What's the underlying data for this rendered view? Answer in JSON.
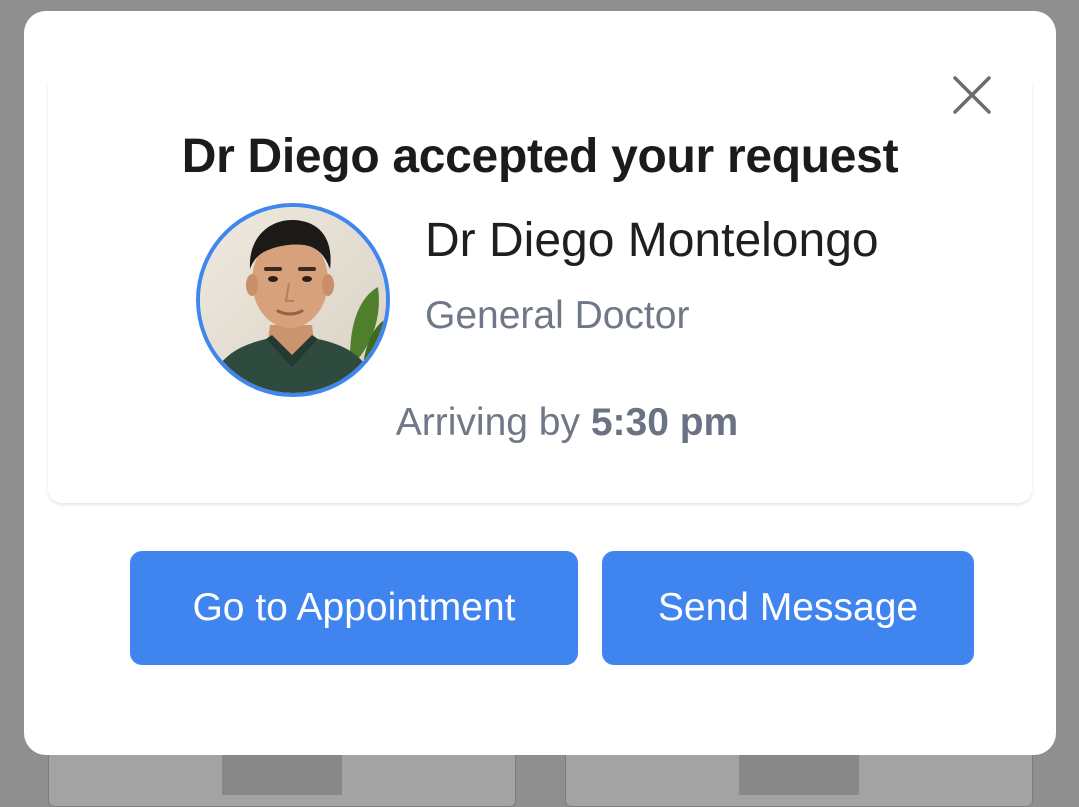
{
  "modal": {
    "title": "Dr Diego accepted your request",
    "doctor": {
      "name": "Dr Diego Montelongo",
      "role": "General Doctor"
    },
    "arrival_prefix": "Arriving by ",
    "arrival_time": "5:30 pm",
    "buttons": {
      "go_to_appointment": "Go to Appointment",
      "send_message": "Send Message"
    },
    "icons": {
      "close": "close-icon",
      "avatar": "doctor-avatar"
    },
    "colors": {
      "accent": "#3f84ef",
      "avatar_border": "#3f86ee",
      "title_text": "#1b1b1b",
      "secondary_text": "#707887",
      "overlay": "#8f8f8f"
    }
  }
}
